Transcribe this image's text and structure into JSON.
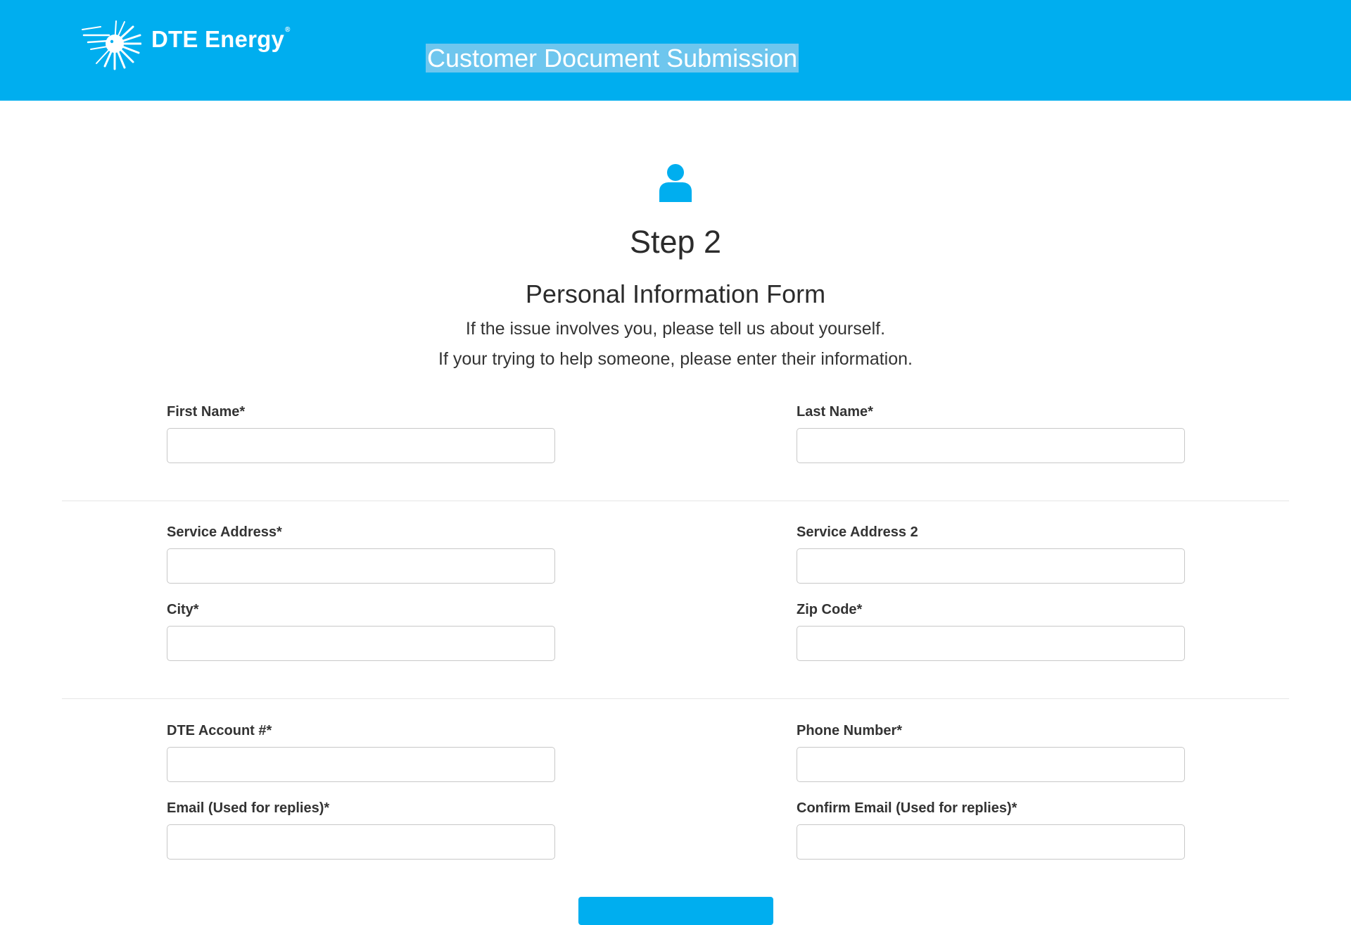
{
  "header": {
    "logo_text": "DTE Energy",
    "logo_mark": "®",
    "title": "Customer Document Submission"
  },
  "main": {
    "icon": "person-icon",
    "step_title": "Step 2",
    "form_title": "Personal Information Form",
    "intro_line1": "If the issue involves you, please tell us about yourself.",
    "intro_line2": "If your trying to help someone, please enter their information."
  },
  "fields": {
    "first_name": {
      "label": "First Name*",
      "value": ""
    },
    "last_name": {
      "label": "Last Name*",
      "value": ""
    },
    "service_address": {
      "label": "Service Address*",
      "value": ""
    },
    "service_address_2": {
      "label": "Service Address 2",
      "value": ""
    },
    "city": {
      "label": "City*",
      "value": ""
    },
    "zip_code": {
      "label": "Zip Code*",
      "value": ""
    },
    "account": {
      "label": "DTE Account #*",
      "value": ""
    },
    "phone": {
      "label": "Phone Number*",
      "value": ""
    },
    "email": {
      "label": "Email (Used for replies)*",
      "value": ""
    },
    "confirm_email": {
      "label": "Confirm Email (Used for replies)*",
      "value": ""
    }
  },
  "colors": {
    "brand": "#00aeef",
    "title_highlight": "#6ec6ee",
    "input_border": "#c8c8c8"
  }
}
